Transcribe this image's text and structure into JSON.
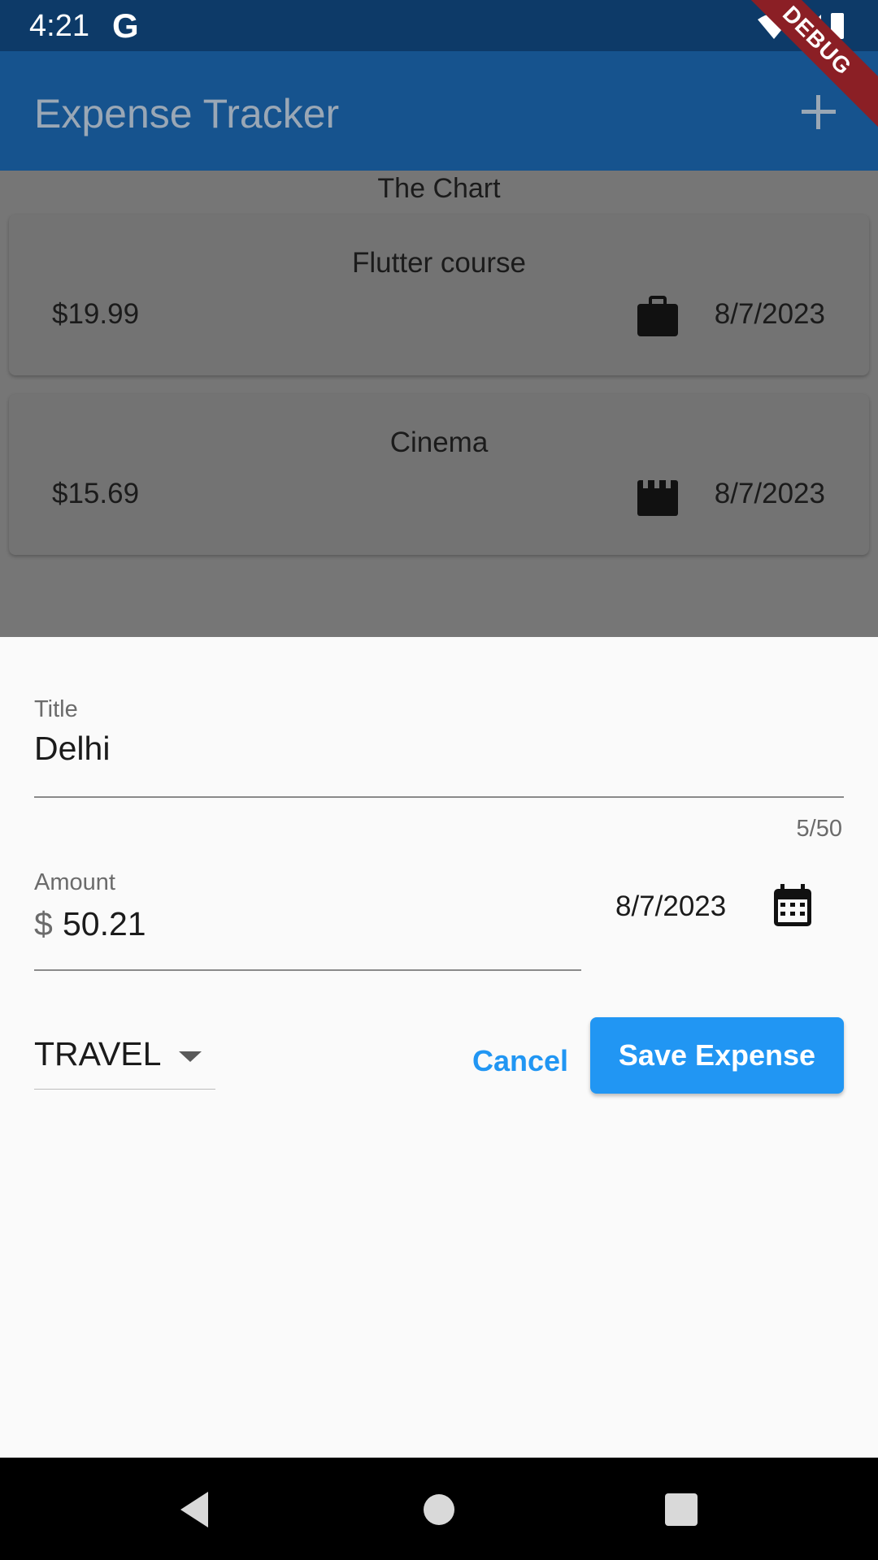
{
  "status_bar": {
    "time": "4:21",
    "g_label": "G"
  },
  "app_bar": {
    "title": "Expense Tracker",
    "debug_label": "DEBUG"
  },
  "chart": {
    "label": "The Chart"
  },
  "expenses": [
    {
      "title": "Flutter course",
      "amount": "$19.99",
      "date": "8/7/2023",
      "icon": "work-briefcase-icon"
    },
    {
      "title": "Cinema",
      "amount": "$15.69",
      "date": "8/7/2023",
      "icon": "movie-clapper-icon"
    }
  ],
  "form": {
    "title_label": "Title",
    "title_value": "Delhi",
    "title_counter": "5/50",
    "amount_label": "Amount",
    "amount_prefix": "$",
    "amount_value": "50.21",
    "selected_date": "8/7/2023",
    "category": "TRAVEL",
    "cancel_label": "Cancel",
    "save_label": "Save Expense"
  },
  "colors": {
    "app_bar": "#16538e",
    "status_bar": "#0d3a68",
    "overlay": "#767676",
    "accent": "#2196f3",
    "debug_banner": "#8b1f25"
  }
}
